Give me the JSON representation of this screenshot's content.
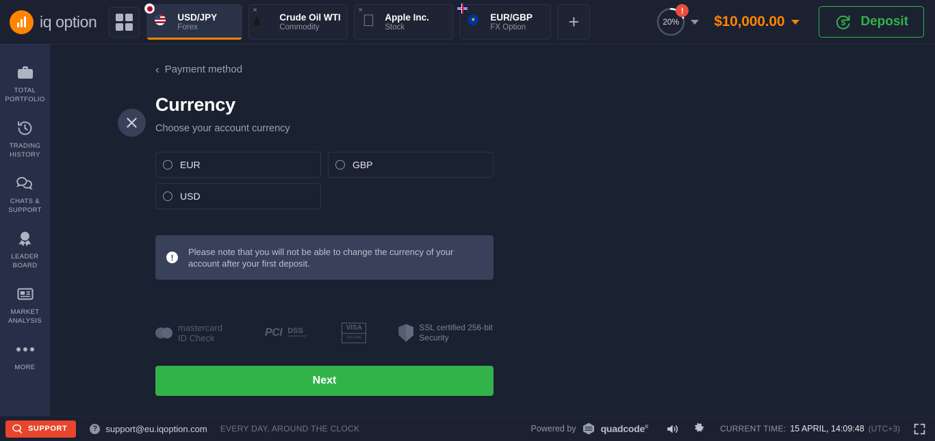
{
  "header": {
    "brand": "iq option",
    "grid_button": "apps-grid",
    "tabs": [
      {
        "name": "USD/JPY",
        "sub": "Forex",
        "icon": "flag-usd-jpy",
        "active": true,
        "close": "×"
      },
      {
        "name": "Crude Oil WTI",
        "sub": "Commodity",
        "icon": "oil-drop",
        "active": false,
        "close": "×"
      },
      {
        "name": "Apple Inc.",
        "sub": "Stock",
        "icon": "apple-logo",
        "active": false,
        "close": "×"
      },
      {
        "name": "EUR/GBP",
        "sub": "FX Option",
        "icon": "flag-eur-gbp",
        "active": false,
        "close": "×"
      }
    ],
    "add_tab_label": "+",
    "progress": {
      "percent_label": "20%",
      "percent_value": 20,
      "alert_badge": "!",
      "ring_color": "#ffffff",
      "track_color": "#4a5268",
      "badge_color": "#eb4d3d"
    },
    "balance": "$10,000.00",
    "balance_color": "#ff8400",
    "deposit_label": "Deposit",
    "deposit_color": "#31b34a"
  },
  "sidebar": {
    "items": [
      {
        "label": "Total\nPortfolio",
        "line1": "TOTAL",
        "line2": "PORTFOLIO",
        "icon": "briefcase-icon"
      },
      {
        "label": "Trading History",
        "line1": "TRADING",
        "line2": "HISTORY",
        "icon": "history-clock-icon"
      },
      {
        "label": "Chats & Support",
        "line1": "CHATS &",
        "line2": "SUPPORT",
        "icon": "chat-bubbles-icon"
      },
      {
        "label": "Leader Board",
        "line1": "LEADER",
        "line2": "BOARD",
        "icon": "award-medal-icon"
      },
      {
        "label": "Market Analysis",
        "line1": "MARKET",
        "line2": "ANALYSIS",
        "icon": "newspaper-icon"
      },
      {
        "label": "More",
        "line1": "MORE",
        "line2": "",
        "icon": "ellipsis-icon"
      }
    ]
  },
  "main": {
    "close_label": "close-panel",
    "breadcrumb": "Payment method",
    "title": "Currency",
    "subtitle": "Choose your account currency",
    "currency_options": [
      {
        "code": "EUR",
        "selected": false
      },
      {
        "code": "GBP",
        "selected": false
      },
      {
        "code": "USD",
        "selected": false
      }
    ],
    "notice": {
      "icon": "exclamation-icon",
      "text": "Please note that you will not be able to change the currency of your account after your first deposit."
    },
    "badges": {
      "mastercard_line1": "mastercard",
      "mastercard_line2": "ID Check",
      "pci_logo": "PCI",
      "pci_dss": "DSS",
      "pci_sub": "COMPLIANT",
      "visa_label": "VISA",
      "visa_sub": "SECURE",
      "ssl_line1": "SSL certified 256-bit",
      "ssl_line2": "Security"
    },
    "next_label": "Next"
  },
  "footer": {
    "support_label": "SUPPORT",
    "email": "support@eu.iqoption.com",
    "everyday": "EVERY DAY, AROUND THE CLOCK",
    "powered_by": "Powered by",
    "quadcode": "quadcode",
    "quadcode_tm": "®",
    "current_time_label": "CURRENT TIME:",
    "current_time_value": "15 APRIL, 14:09:48",
    "timezone": "(UTC+3)"
  }
}
